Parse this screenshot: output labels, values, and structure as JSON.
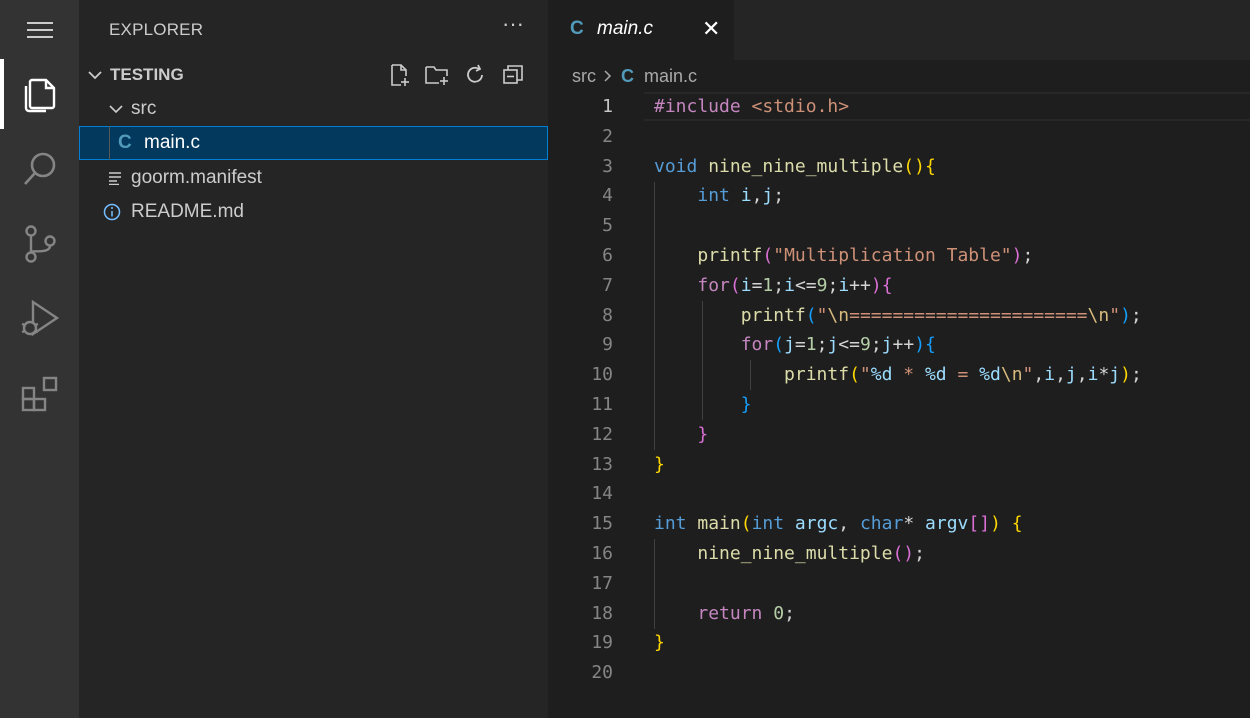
{
  "sidebar": {
    "title": "EXPLORER",
    "more": "···",
    "section": "TESTING",
    "items": [
      {
        "label": "src"
      },
      {
        "label": "main.c",
        "icon_text": "C"
      },
      {
        "label": "goorm.manifest"
      },
      {
        "label": "README.md"
      }
    ]
  },
  "editor": {
    "tab": {
      "icon_text": "C",
      "label": "main.c",
      "close": "✕"
    },
    "breadcrumb": {
      "folder": "src",
      "icon_text": "C",
      "file": "main.c"
    },
    "active_line": 1
  },
  "colors": {
    "activity_bar": "#333333",
    "sidebar": "#252526",
    "editor": "#1e1e1e",
    "selection": "#04395e",
    "c_icon": "#519aba"
  },
  "code_lines": [
    [
      [
        "#include ",
        "pp"
      ],
      [
        "<stdio.h>",
        "str"
      ]
    ],
    [],
    [
      [
        "void ",
        "type"
      ],
      [
        "nine_nine_multiple",
        "fn"
      ],
      [
        "(",
        "b1"
      ],
      [
        ")",
        "b1"
      ],
      [
        "{",
        "b1"
      ]
    ],
    [
      [
        "    "
      ],
      [
        "int ",
        "type"
      ],
      [
        "i",
        "var"
      ],
      [
        ",",
        "op"
      ],
      [
        "j",
        "var"
      ],
      [
        ";",
        "op"
      ]
    ],
    [],
    [
      [
        "    "
      ],
      [
        "printf",
        "fn"
      ],
      [
        "(",
        "b2"
      ],
      [
        "\"Multiplication Table\"",
        "str"
      ],
      [
        ")",
        "b2"
      ],
      [
        ";",
        "op"
      ]
    ],
    [
      [
        "    "
      ],
      [
        "for",
        "ctl"
      ],
      [
        "(",
        "b2"
      ],
      [
        "i",
        "var"
      ],
      [
        "=",
        "op"
      ],
      [
        "1",
        "num"
      ],
      [
        ";",
        "op"
      ],
      [
        "i",
        "var"
      ],
      [
        "<=",
        "op"
      ],
      [
        "9",
        "num"
      ],
      [
        ";",
        "op"
      ],
      [
        "i",
        "var"
      ],
      [
        "++",
        "op"
      ],
      [
        ")",
        "b2"
      ],
      [
        "{",
        "b2"
      ]
    ],
    [
      [
        "        "
      ],
      [
        "printf",
        "fn"
      ],
      [
        "(",
        "b3"
      ],
      [
        "\"",
        "str"
      ],
      [
        "\\n",
        "esc"
      ],
      [
        "======================",
        "str"
      ],
      [
        "\\n",
        "esc"
      ],
      [
        "\"",
        "str"
      ],
      [
        ")",
        "b3"
      ],
      [
        ";",
        "op"
      ]
    ],
    [
      [
        "        "
      ],
      [
        "for",
        "ctl"
      ],
      [
        "(",
        "b3"
      ],
      [
        "j",
        "var"
      ],
      [
        "=",
        "op"
      ],
      [
        "1",
        "num"
      ],
      [
        ";",
        "op"
      ],
      [
        "j",
        "var"
      ],
      [
        "<=",
        "op"
      ],
      [
        "9",
        "num"
      ],
      [
        ";",
        "op"
      ],
      [
        "j",
        "var"
      ],
      [
        "++",
        "op"
      ],
      [
        ")",
        "b3"
      ],
      [
        "{",
        "b3"
      ]
    ],
    [
      [
        "            "
      ],
      [
        "printf",
        "fn"
      ],
      [
        "(",
        "b1"
      ],
      [
        "\"",
        "str"
      ],
      [
        "%d",
        "fmt"
      ],
      [
        " * ",
        "str"
      ],
      [
        "%d",
        "fmt"
      ],
      [
        " = ",
        "str"
      ],
      [
        "%d",
        "fmt"
      ],
      [
        "\\n",
        "esc"
      ],
      [
        "\"",
        "str"
      ],
      [
        ",",
        "op"
      ],
      [
        "i",
        "var"
      ],
      [
        ",",
        "op"
      ],
      [
        "j",
        "var"
      ],
      [
        ",",
        "op"
      ],
      [
        "i",
        "var"
      ],
      [
        "*",
        "op"
      ],
      [
        "j",
        "var"
      ],
      [
        ")",
        "b1"
      ],
      [
        ";",
        "op"
      ]
    ],
    [
      [
        "        "
      ],
      [
        "}",
        "b3"
      ]
    ],
    [
      [
        "    "
      ],
      [
        "}",
        "b2"
      ]
    ],
    [
      [
        "}",
        "b1"
      ]
    ],
    [],
    [
      [
        "int ",
        "type"
      ],
      [
        "main",
        "fn"
      ],
      [
        "(",
        "b1"
      ],
      [
        "int ",
        "type"
      ],
      [
        "argc",
        "var"
      ],
      [
        ", ",
        "op"
      ],
      [
        "char",
        "type"
      ],
      [
        "* ",
        "op"
      ],
      [
        "argv",
        "var"
      ],
      [
        "[",
        "b2"
      ],
      [
        "]",
        "b2"
      ],
      [
        ")",
        "b1"
      ],
      [
        " "
      ],
      [
        "{",
        "b1"
      ]
    ],
    [
      [
        "    "
      ],
      [
        "nine_nine_multiple",
        "fn"
      ],
      [
        "(",
        "b2"
      ],
      [
        ")",
        "b2"
      ],
      [
        ";",
        "op"
      ]
    ],
    [],
    [
      [
        "    "
      ],
      [
        "return ",
        "ctl"
      ],
      [
        "0",
        "num"
      ],
      [
        ";",
        "op"
      ]
    ],
    [
      [
        "}",
        "b1"
      ]
    ],
    []
  ]
}
